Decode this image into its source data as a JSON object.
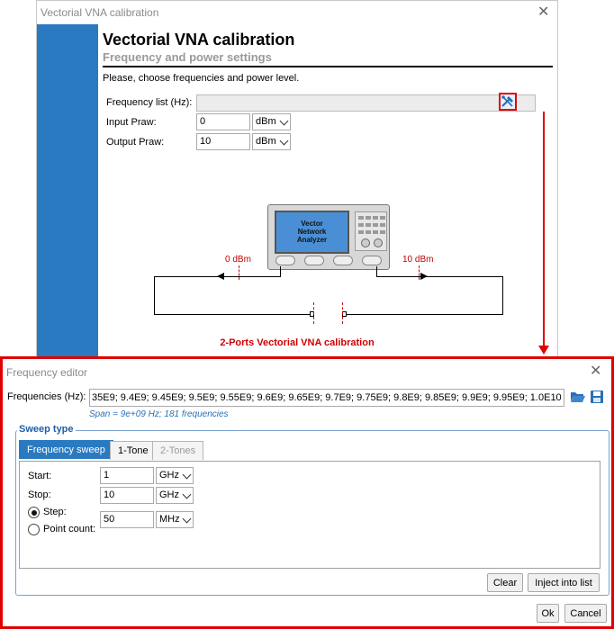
{
  "main_window": {
    "title": "Vectorial VNA calibration",
    "heading": "Vectorial VNA calibration",
    "subheading": "Frequency and power settings",
    "instruction": "Please, choose frequencies and power level.",
    "frequency_list_label": "Frequency list (Hz):",
    "frequency_list_value": "",
    "input_power_label": "Input Praw:",
    "input_power_value": "0",
    "input_power_unit": "dBm",
    "output_power_label": "Output Praw:",
    "output_power_value": "10",
    "output_power_unit": "dBm",
    "instrument_label": "Vector\nNetwork\nAnalyzer",
    "port1_power": "0 dBm",
    "port2_power": "10 dBm",
    "caption": "2-Ports Vectorial VNA calibration",
    "accent_color": "#2a7ac1",
    "callout_color": "#e00000"
  },
  "frequency_editor": {
    "title": "Frequency editor",
    "frequencies_label": "Frequencies (Hz):",
    "frequencies_value": "35E9; 9.4E9; 9.45E9; 9.5E9; 9.55E9; 9.6E9; 9.65E9; 9.7E9; 9.75E9; 9.8E9; 9.85E9; 9.9E9; 9.95E9; 1.0E10",
    "span_info": "Span = 9e+09 Hz; 181 frequencies",
    "sweep_type_title": "Sweep type",
    "tabs": [
      {
        "label": "Frequency sweep",
        "state": "selected"
      },
      {
        "label": "1-Tone",
        "state": "normal"
      },
      {
        "label": "2-Tones",
        "state": "disabled"
      }
    ],
    "start_label": "Start:",
    "start_value": "1",
    "start_unit": "GHz",
    "stop_label": "Stop:",
    "stop_value": "10",
    "stop_unit": "GHz",
    "step_label": "Step:",
    "step_selected": true,
    "point_count_label": "Point count:",
    "step_value": "50",
    "step_unit": "MHz",
    "clear_button": "Clear",
    "inject_button": "Inject into list",
    "ok_button": "Ok",
    "cancel_button": "Cancel",
    "icons": [
      "close-icon",
      "folder-open-icon",
      "save-icon",
      "chevron-down-icon",
      "frequency-tool-icon"
    ]
  }
}
